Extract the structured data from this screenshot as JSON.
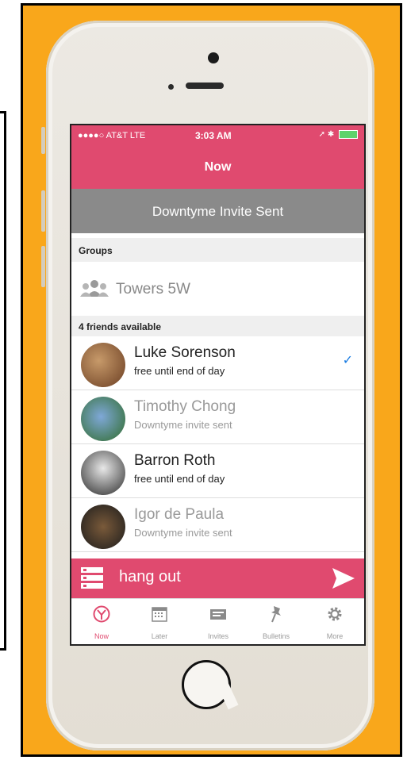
{
  "status_bar": {
    "carrier": "●●●●○ AT&T  LTE",
    "time": "3:03 AM",
    "right": "➚ ✱"
  },
  "nav": {
    "title": "Now"
  },
  "banner": {
    "text": "Downtyme Invite Sent"
  },
  "groups": {
    "header": "Groups",
    "items": [
      {
        "name": "Towers 5W",
        "icon": "group-icon"
      }
    ]
  },
  "friends": {
    "header": "4 friends available",
    "items": [
      {
        "name": "Luke Sorenson",
        "status": "free until end of day",
        "selected": true
      },
      {
        "name": "Timothy Chong",
        "status": "Downtyme invite sent",
        "selected": false
      },
      {
        "name": "Barron Roth",
        "status": "free until end of day",
        "selected": false
      },
      {
        "name": "Igor de Paula",
        "status": "Downtyme invite sent",
        "selected": false
      }
    ],
    "check_glyph": "✓"
  },
  "action_bar": {
    "text": "hang out"
  },
  "tabs": [
    {
      "label": "Now",
      "icon": "now-icon"
    },
    {
      "label": "Later",
      "icon": "calendar-icon"
    },
    {
      "label": "Invites",
      "icon": "invites-icon"
    },
    {
      "label": "Bulletins",
      "icon": "pin-icon"
    },
    {
      "label": "More",
      "icon": "gear-icon"
    }
  ],
  "colors": {
    "accent": "#e04a6f",
    "banner": "#8a8a8a",
    "frame": "#f9a71b",
    "check": "#1a7ce2"
  }
}
